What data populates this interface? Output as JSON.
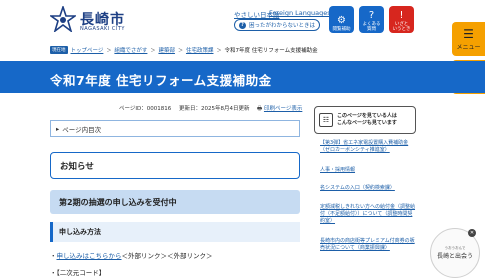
{
  "header": {
    "logo_name": "長崎市",
    "logo_sub": "NAGASAKI CITY",
    "link_foreign": "Foreign Languages",
    "help_text": "困ったがわからないときは",
    "tiles": [
      {
        "label": "閲覧補助",
        "icon": "accessibility-icon",
        "color": "#1668c8"
      },
      {
        "label": "よくある\n質問",
        "icon": "faq-icon",
        "color": "#1668c8"
      },
      {
        "label": "いざと\nいうとき",
        "icon": "emergency-icon",
        "color": "#d7261e"
      }
    ],
    "menu_label": "メニュー",
    "search_label": "検索"
  },
  "breadcrumb": {
    "tag": "現在地",
    "items": [
      "トップページ",
      "組織でさがす",
      "建築部",
      "住宅政策課"
    ],
    "current": "令和7年度 住宅リフォーム支援補助金"
  },
  "page": {
    "title": "令和7年度 住宅リフォーム支援補助金",
    "page_id": "ページID：0001816",
    "updated": "更新日：2025年8月4日更新",
    "print": "印刷ページ表示",
    "toc": "ページ内目次",
    "notice": "お知らせ",
    "h2": "第2期の抽選の申し込みを受付中",
    "h3": "申し込み方法",
    "bullet1_link": "申し込みはこちらから",
    "bullet1_rest": "＜外部リンク＞＜外部リンク＞",
    "bullet2": "・【二次元コード】"
  },
  "sidebar": {
    "box_text": "このページを見ている人は\nこんなページも見ています",
    "links": [
      "【第3弾】省エネ家電設置購入費補助金（ゼロカーボンシティ推進室）",
      "人事・採用情報",
      "名システムの入口（契約検索課）",
      "定額減税しきれない方への給付金（調整給付（不足額給付））について（調整時間契約室）",
      "長崎市内の商店街等プレミアム付商券の販売状況について（商業振興課）"
    ]
  },
  "mascot": {
    "small": "うおうおんで",
    "big": "長崎と出会う"
  }
}
